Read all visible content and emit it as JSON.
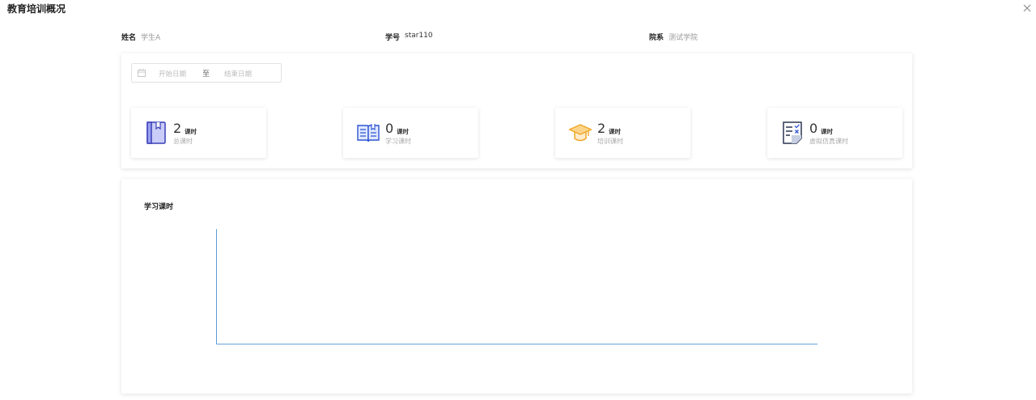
{
  "header": {
    "title": "教育培训概况"
  },
  "student": {
    "name_label": "姓名",
    "name_value": "学生A",
    "id_label": "学号",
    "id_value": "star110",
    "dept_label": "院系",
    "dept_value": "测试学院"
  },
  "date_range": {
    "start_placeholder": "开始日期",
    "separator": "至",
    "end_placeholder": "结束日期"
  },
  "stats": [
    {
      "value": "2",
      "unit": "课时",
      "label": "总课时",
      "icon": "book-icon"
    },
    {
      "value": "0",
      "unit": "课时",
      "label": "学习课时",
      "icon": "open-book-icon"
    },
    {
      "value": "2",
      "unit": "课时",
      "label": "培训课时",
      "icon": "graduation-cap-icon"
    },
    {
      "value": "0",
      "unit": "课时",
      "label": "虚拟仿真课时",
      "icon": "simulation-sheet-icon"
    }
  ],
  "colors": {
    "blue": "#3b6ef5",
    "gold": "#f5b43c",
    "axis": "#5b9bd5"
  },
  "chart_data": {
    "type": "line",
    "title": "学习课时",
    "series": [],
    "x": [],
    "grid": false
  }
}
